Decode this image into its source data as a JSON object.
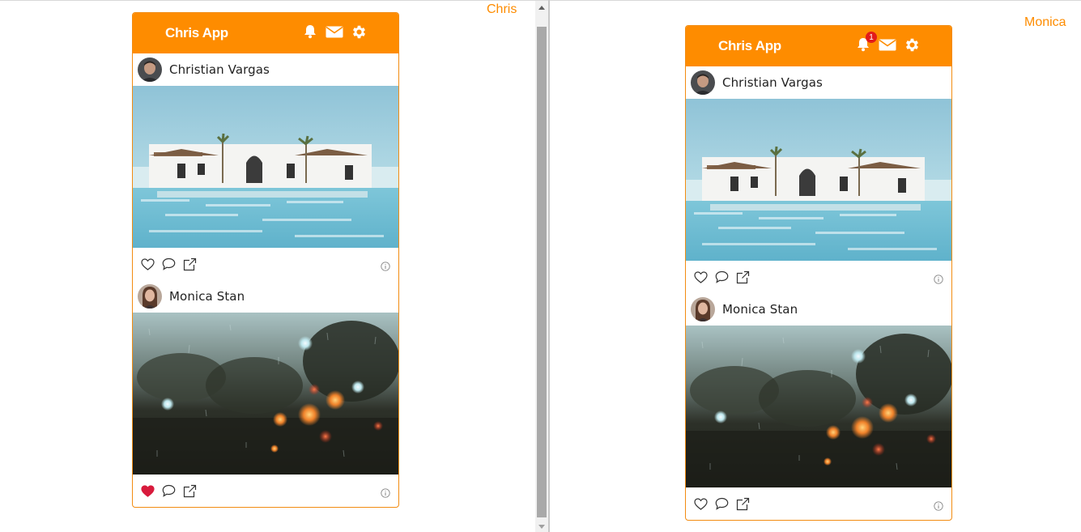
{
  "colors": {
    "accent": "#fe8c00",
    "heart_liked": "#d81b3c",
    "badge": "#e21b1b",
    "border": "#f28c12"
  },
  "left": {
    "user_label": "Chris",
    "app": {
      "title": "Chris App",
      "header_icons": [
        "bell-icon",
        "mail-icon",
        "gear-icon"
      ],
      "notifications_badge": "",
      "posts": [
        {
          "author": "Christian Vargas",
          "image": "villa-pool-photo",
          "liked": false
        },
        {
          "author": "Monica Stan",
          "image": "rainy-window-photo",
          "liked": true
        }
      ]
    }
  },
  "right": {
    "user_label": "Monica",
    "app": {
      "title": "Chris App",
      "header_icons": [
        "bell-icon",
        "mail-icon",
        "gear-icon"
      ],
      "notifications_badge": "1",
      "posts": [
        {
          "author": "Christian Vargas",
          "image": "villa-pool-photo",
          "liked": false
        },
        {
          "author": "Monica Stan",
          "image": "rainy-window-photo",
          "liked": false
        }
      ]
    }
  }
}
